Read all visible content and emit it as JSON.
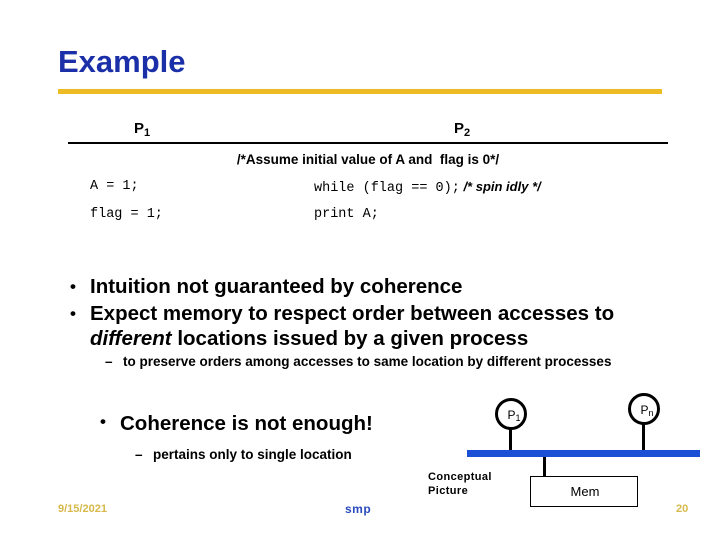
{
  "slide": {
    "title": "Example",
    "accent_gold": "#edbb24",
    "title_blue": "#1a2fa8",
    "bus_blue": "#1a4fd6"
  },
  "code_table": {
    "columns": [
      {
        "label": "P",
        "sub": "1"
      },
      {
        "label": "P",
        "sub": "2"
      }
    ],
    "comment_line": "/*Assume initial value of A and  flag is 0*/",
    "rows": [
      {
        "left": "A = 1;",
        "right": "while (flag == 0);",
        "right_comment": " /* spin idly */"
      },
      {
        "left": "flag = 1;",
        "right": "print A;",
        "right_comment": ""
      }
    ]
  },
  "bullets": {
    "item1": "Intuition not guaranteed by coherence",
    "item2_part1": "Expect memory to respect order between accesses to ",
    "item2_emphasis": "different",
    "item2_part2": " locations issued by a given process",
    "item2_sub": "to preserve orders among accesses to same location by different processes",
    "item3": "Coherence is not enough!",
    "item3_sub": "pertains only to single location"
  },
  "diagram": {
    "caption": "Conceptual\nPicture",
    "node_p1": {
      "label": "P",
      "sub": "1"
    },
    "node_pn": {
      "label": "P",
      "sub": "n"
    },
    "memory_label": "Mem"
  },
  "footer": {
    "date": "9/15/2021",
    "center": "smp",
    "page": "20"
  }
}
